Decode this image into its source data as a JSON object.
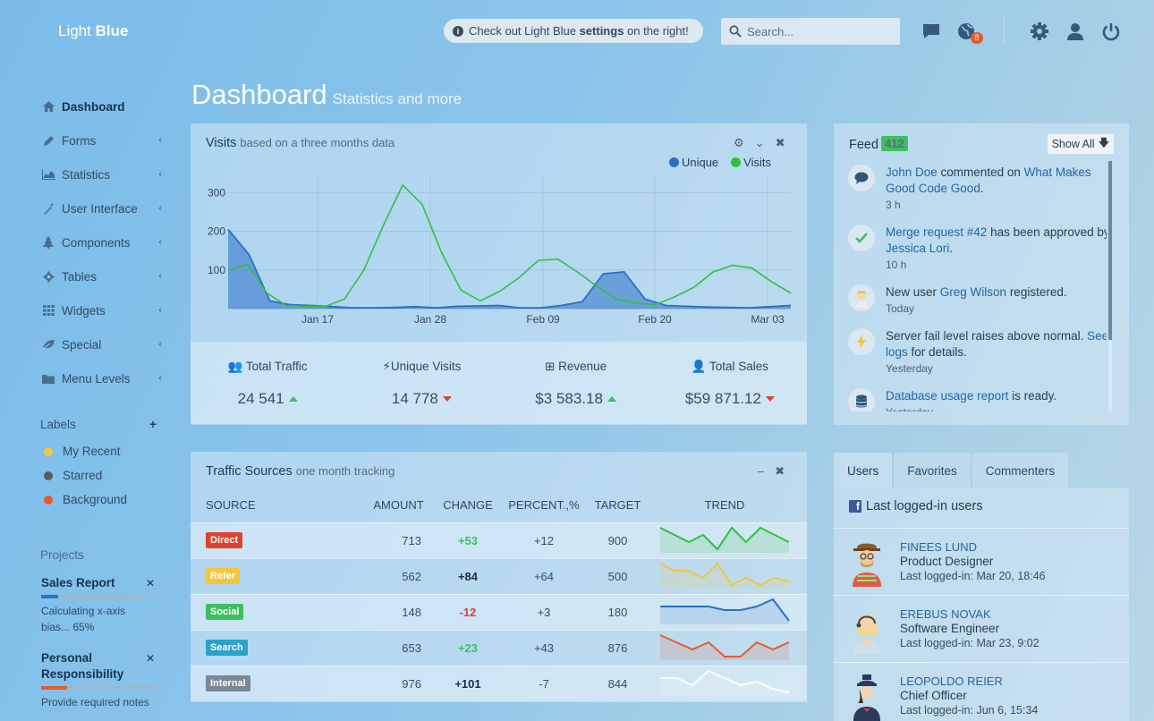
{
  "header": {
    "logo_light": "Light",
    "logo_blue": "Blue",
    "notice_pre": "Check out Light Blue ",
    "notice_bold": "settings",
    "notice_post": " on the right!",
    "search_placeholder": "Search...",
    "notifications_count": "8",
    "icons": [
      "chat-icon",
      "globe-icon",
      "gear-icon",
      "user-icon",
      "power-icon"
    ]
  },
  "sidebar": {
    "items": [
      {
        "label": "Dashboard",
        "icon": "home-icon",
        "active": true
      },
      {
        "label": "Forms",
        "icon": "pencil-icon"
      },
      {
        "label": "Statistics",
        "icon": "area-chart-icon"
      },
      {
        "label": "User Interface",
        "icon": "magic-wand-icon"
      },
      {
        "label": "Components",
        "icon": "tree-icon"
      },
      {
        "label": "Tables",
        "icon": "cog-icon"
      },
      {
        "label": "Widgets",
        "icon": "grid-icon"
      },
      {
        "label": "Special",
        "icon": "leaf-icon"
      },
      {
        "label": "Menu Levels",
        "icon": "folder-icon"
      }
    ],
    "labels_title": "Labels",
    "labels": [
      {
        "label": "My Recent",
        "color": "#f3c63f"
      },
      {
        "label": "Starred",
        "color": "#5a5a5a"
      },
      {
        "label": "Background",
        "color": "#e8592b"
      }
    ],
    "projects_title": "Projects",
    "projects": [
      {
        "title": "Sales Report",
        "desc": "Calculating x-axis bias... 65%",
        "progress": 0.15,
        "color": "#2b76c8"
      },
      {
        "title": "Personal Responsibility",
        "desc": "Provide required notes",
        "progress": 0.23,
        "color": "#e8592b"
      }
    ]
  },
  "page": {
    "title": "Dashboard",
    "subtitle": "Statistics and more"
  },
  "visits": {
    "title": "Visits",
    "subtitle": "based on a three months data",
    "legend": [
      {
        "name": "Unique",
        "color": "#2b6fc8"
      },
      {
        "name": "Visits",
        "color": "#2ec23f"
      }
    ],
    "stats": [
      {
        "label": "Total Traffic",
        "icon": "users-icon",
        "value": "24 541",
        "trend": "up"
      },
      {
        "label": "Unique Visits",
        "icon": "bolt-icon",
        "value": "14 778",
        "trend": "down"
      },
      {
        "label": "Revenue",
        "icon": "plus-square-icon",
        "value": "$3 583.18",
        "trend": "up"
      },
      {
        "label": "Total Sales",
        "icon": "user-icon",
        "value": "$59 871.12",
        "trend": "down"
      }
    ]
  },
  "chart_data": {
    "type": "line",
    "x_ticks": [
      "Jan 17",
      "Jan 28",
      "Feb 09",
      "Feb 20",
      "Mar 03"
    ],
    "y_ticks": [
      100,
      200,
      300
    ],
    "ylim": [
      0,
      345
    ],
    "series": [
      {
        "name": "Unique",
        "type": "area",
        "color": "#2b6fc8",
        "values": [
          205,
          140,
          20,
          10,
          8,
          5,
          2,
          2,
          3,
          5,
          2,
          6,
          7,
          8,
          2,
          2,
          8,
          18,
          90,
          95,
          25,
          8,
          6,
          4,
          3,
          2,
          5,
          8
        ]
      },
      {
        "name": "Visits",
        "type": "line",
        "color": "#2ec23f",
        "values": [
          100,
          115,
          40,
          8,
          6,
          5,
          25,
          100,
          215,
          320,
          270,
          145,
          48,
          20,
          45,
          80,
          125,
          128,
          95,
          58,
          25,
          15,
          10,
          30,
          55,
          95,
          112,
          105,
          70,
          40
        ]
      }
    ]
  },
  "feed": {
    "title": "Feed",
    "count": "412",
    "show_all": "Show All",
    "items": [
      {
        "icon": "comment-icon",
        "pre": "",
        "link1": "John Doe",
        "mid": " commented on ",
        "link2": "What Makes Good Code Good",
        "post": ".",
        "time": "3 h"
      },
      {
        "icon": "check-icon",
        "pre": "",
        "link1": "Merge request #42",
        "mid": " has been approved by ",
        "link2": "Jessica Lori",
        "post": ".",
        "time": "10 h"
      },
      {
        "icon": "avatar-icon",
        "pre": "New user ",
        "link1": "Greg Wilson",
        "mid": " registered.",
        "link2": "",
        "post": "",
        "time": "Today"
      },
      {
        "icon": "bolt-icon",
        "pre": "Server fail level raises above normal. ",
        "link1": "See logs",
        "mid": " for details.",
        "link2": "",
        "post": "",
        "time": "Yesterday"
      },
      {
        "icon": "database-icon",
        "pre": "",
        "link1": "Database usage report",
        "mid": " is ready.",
        "link2": "",
        "post": "",
        "time": "Yesterday"
      }
    ]
  },
  "traffic": {
    "title": "Traffic Sources",
    "subtitle": "one month tracking",
    "columns": [
      "Source",
      "Amount",
      "Change",
      "Percent.,%",
      "Target",
      "Trend"
    ],
    "rows": [
      {
        "source": "Direct",
        "color": "#e0412f",
        "amount": "713",
        "change": "+53",
        "change_style": "g",
        "percent": "+12",
        "target": "900",
        "trend_color": "#2ec23f",
        "trend": [
          3,
          2,
          1,
          2,
          0,
          3,
          1,
          3,
          2,
          1
        ]
      },
      {
        "source": "Refer",
        "color": "#f3c63f",
        "amount": "562",
        "change": "+84",
        "change_style": "b",
        "percent": "+64",
        "target": "500",
        "trend_color": "#f3c63f",
        "trend": [
          3,
          2,
          2,
          1,
          3,
          0,
          1,
          0,
          1,
          0.5
        ]
      },
      {
        "source": "Social",
        "color": "#3fbf5f",
        "amount": "148",
        "change": "-12",
        "change_style": "r",
        "percent": "+3",
        "target": "180",
        "trend_color": "#2b6fc8",
        "trend": [
          2,
          2,
          2,
          2,
          1.5,
          1.5,
          2,
          3,
          0
        ]
      },
      {
        "source": "Search",
        "color": "#2aa3c8",
        "amount": "653",
        "change": "+23",
        "change_style": "g",
        "percent": "+43",
        "target": "876",
        "trend_color": "#e8592b",
        "trend": [
          3,
          2,
          1,
          2,
          0,
          0,
          2,
          1,
          2
        ]
      },
      {
        "source": "Internal",
        "color": "#7a8896",
        "amount": "976",
        "change": "+101",
        "change_style": "b",
        "percent": "-7",
        "target": "844",
        "trend_color": "#ffffff",
        "trend": [
          2,
          2,
          1,
          3,
          2,
          1,
          1.5,
          0.5,
          0
        ]
      }
    ]
  },
  "users": {
    "tabs": [
      "Users",
      "Favorites",
      "Commenters"
    ],
    "heading": "Last logged-in users",
    "list": [
      {
        "name": "Finees Lund",
        "role": "Product Designer",
        "last": "Last logged-in: Mar 20, 18:46"
      },
      {
        "name": "Erebus Novak",
        "role": "Software Engineer",
        "last": "Last logged-in: Mar 23, 9:02"
      },
      {
        "name": "Leopoldo Reier",
        "role": "Chief Officer",
        "last": "Last logged-in: Jun 6, 15:34"
      }
    ]
  }
}
